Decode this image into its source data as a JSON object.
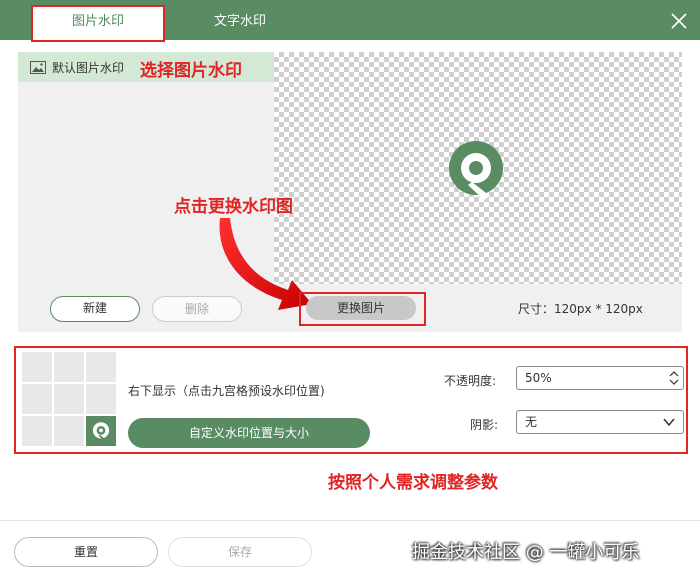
{
  "tabs": [
    {
      "label": "图片水印"
    },
    {
      "label": "文字水印"
    }
  ],
  "annotations": {
    "select_image": "选择图片水印",
    "change_image": "点击更换水印图",
    "adjust_params": "按照个人需求调整参数"
  },
  "watermark_list": {
    "items": [
      {
        "label": "默认图片水印"
      }
    ]
  },
  "buttons": {
    "new": "新建",
    "delete": "删除",
    "change_image": "更换图片",
    "custom_position": "自定义水印位置与大小",
    "reset": "重置",
    "save": "保存"
  },
  "size_label": "尺寸：120px * 120px",
  "position": {
    "text": "右下显示（点击九宫格预设水印位置)",
    "active_cell": "bottom-right"
  },
  "opacity": {
    "label": "不透明度:",
    "value": "50%"
  },
  "shadow": {
    "label": "阴影:",
    "value": "无"
  },
  "page_watermark": "掘金技术社区 @ 一罐小可乐",
  "colors": {
    "brand_green": "#5a8c64",
    "annotation_red": "#e02525",
    "selected_row": "#d4e8d6"
  }
}
